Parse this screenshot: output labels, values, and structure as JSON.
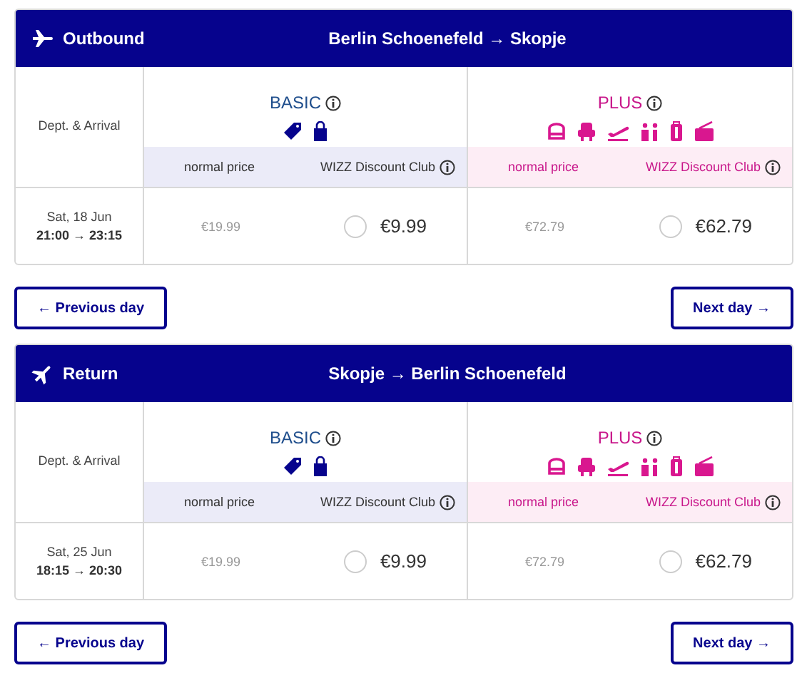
{
  "sections": [
    {
      "kind": "outbound",
      "title": "Outbound",
      "route": "Berlin Schoenefeld → Skopje",
      "column_label": "Dept. & Arrival",
      "date": "Sat, 18 Jun",
      "times": "21:00 → 23:15",
      "fares": [
        {
          "kind": "basic",
          "name": "BASIC",
          "normal_label": "normal price",
          "club_label": "WIZZ Discount Club",
          "normal_price": "€19.99",
          "club_price": "€9.99",
          "selected": false
        },
        {
          "kind": "plus",
          "name": "PLUS",
          "normal_label": "normal price",
          "club_label": "WIZZ Discount Club",
          "normal_price": "€72.79",
          "club_price": "€62.79",
          "selected": false
        }
      ],
      "prev_button": "← Previous day",
      "next_button": "Next day →"
    },
    {
      "kind": "return",
      "title": "Return",
      "route": "Skopje → Berlin Schoenefeld",
      "column_label": "Dept. & Arrival",
      "date": "Sat, 25 Jun",
      "times": "18:15 → 20:30",
      "fares": [
        {
          "kind": "basic",
          "name": "BASIC",
          "normal_label": "normal price",
          "club_label": "WIZZ Discount Club",
          "normal_price": "€19.99",
          "club_price": "€9.99",
          "selected": false
        },
        {
          "kind": "plus",
          "name": "PLUS",
          "normal_label": "normal price",
          "club_label": "WIZZ Discount Club",
          "normal_price": "€72.79",
          "club_price": "€62.79",
          "selected": false
        }
      ],
      "prev_button": "← Previous day",
      "next_button": "Next day →"
    }
  ]
}
